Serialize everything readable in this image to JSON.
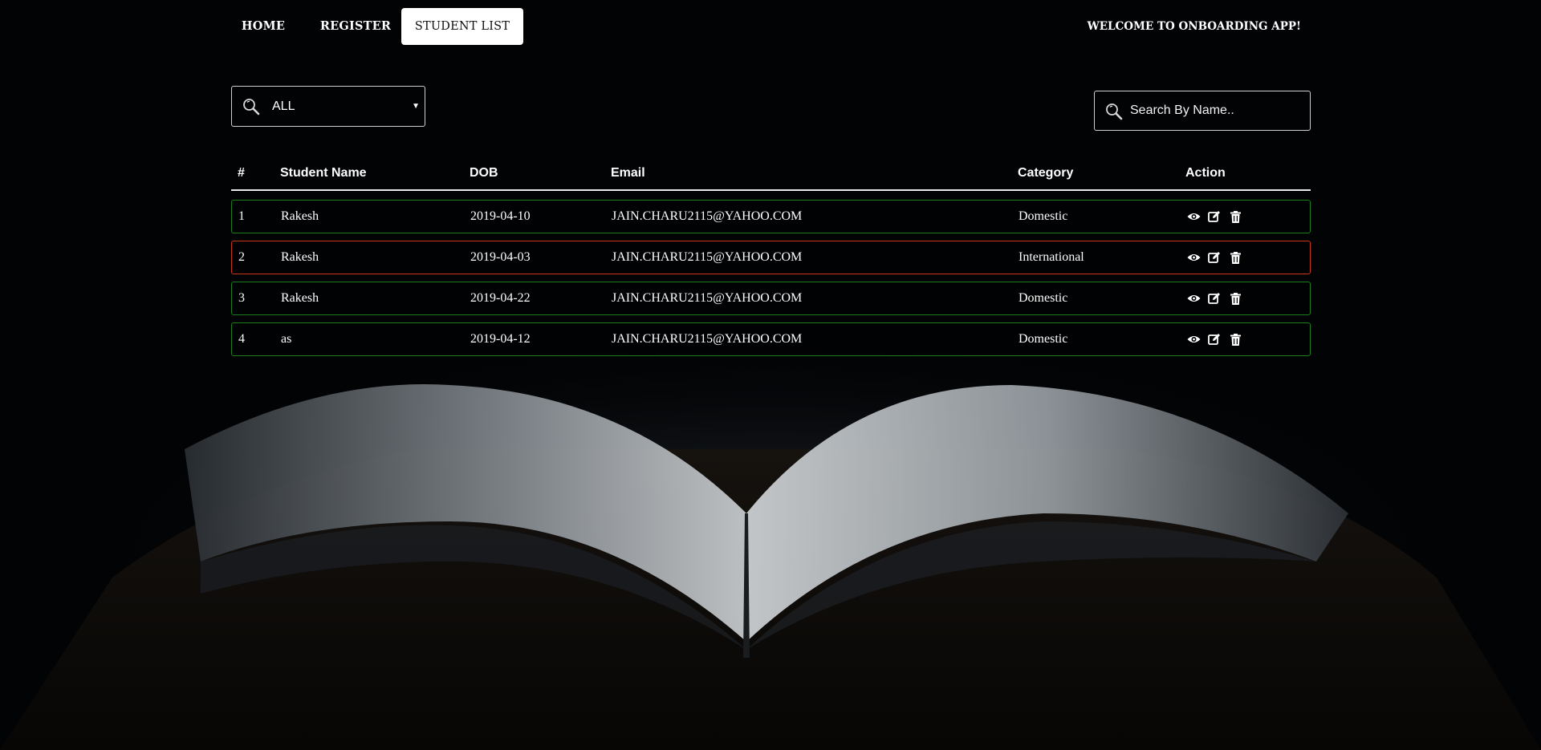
{
  "nav": {
    "home": "HOME",
    "register": "REGISTER",
    "student_list": "STUDENT LIST",
    "welcome": "WELCOME TO ONBOARDING APP!"
  },
  "filter": {
    "selected": "ALL",
    "icon": "search-icon"
  },
  "search": {
    "placeholder": "Search By Name..",
    "value": "",
    "icon": "search-icon"
  },
  "table": {
    "headers": [
      "#",
      "Student Name",
      "DOB",
      "Email",
      "Category",
      "Action"
    ],
    "rows": [
      {
        "index": "1",
        "name": "Rakesh",
        "dob": "2019-04-10",
        "email": "JAIN.CHARU2115@YAHOO.COM",
        "category": "Domestic"
      },
      {
        "index": "2",
        "name": "Rakesh",
        "dob": "2019-04-03",
        "email": "JAIN.CHARU2115@YAHOO.COM",
        "category": "International"
      },
      {
        "index": "3",
        "name": "Rakesh",
        "dob": "2019-04-22",
        "email": "JAIN.CHARU2115@YAHOO.COM",
        "category": "Domestic"
      },
      {
        "index": "4",
        "name": "as",
        "dob": "2019-04-12",
        "email": "JAIN.CHARU2115@YAHOO.COM",
        "category": "Domestic"
      }
    ],
    "action_icons": [
      "eye-icon",
      "edit-icon",
      "trash-icon"
    ]
  },
  "colors": {
    "background": "#020305",
    "domestic_border": "#1e7d1e",
    "international_border": "#c8361c",
    "active_tab_bg": "#ffffff"
  }
}
